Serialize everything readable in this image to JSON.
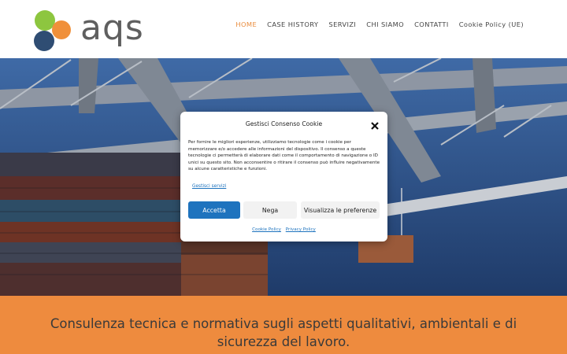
{
  "header": {
    "logo_text": "aqs",
    "nav": [
      {
        "label": "HOME",
        "active": true
      },
      {
        "label": "CASE HISTORY",
        "active": false
      },
      {
        "label": "SERVIZI",
        "active": false
      },
      {
        "label": "CHI SIAMO",
        "active": false
      },
      {
        "label": "CONTATTI",
        "active": false
      },
      {
        "label": "Cookie Policy (UE)",
        "active": false
      }
    ]
  },
  "cookie_modal": {
    "title": "Gestisci Consenso Cookie",
    "body": "Per fornire le migliori esperienze, utilizziamo tecnologie come i cookie per memorizzare e/o accedere alle informazioni del dispositivo. Il consenso a queste tecnologie ci permetterà di elaborare dati come il comportamento di navigazione o ID unici su questo sito. Non acconsentire o ritirare il consenso può influire negativamente su alcune caratteristiche e funzioni.",
    "manage_link": "Gestisci servizi",
    "accept_label": "Accetta",
    "deny_label": "Nega",
    "preferences_label": "Visualizza le preferenze",
    "cookie_policy_link": "Cookie Policy",
    "privacy_policy_link": "Privacy Policy"
  },
  "band": {
    "tagline": "Consulenza tecnica e normativa sugli aspetti qualitativi, ambientali e di sicurezza del lavoro."
  },
  "colors": {
    "accent_orange": "#ee8b3e",
    "link_blue": "#1e73be",
    "logo_green": "#8dc63f",
    "logo_orange": "#f0903a",
    "logo_navy": "#2f4d73"
  }
}
